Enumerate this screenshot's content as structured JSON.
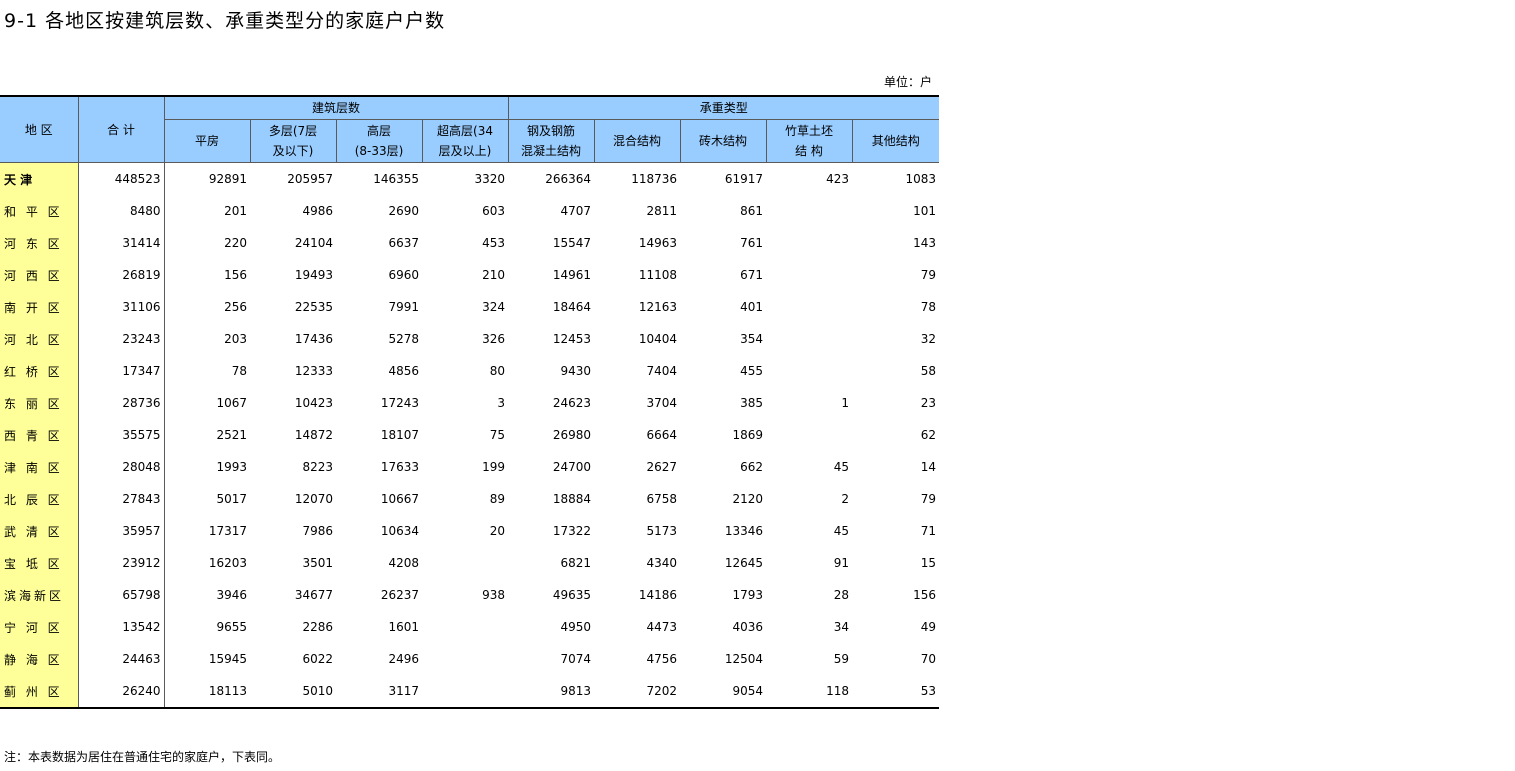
{
  "title": "9-1   各地区按建筑层数、承重类型分的家庭户户数",
  "unit": "单位：户",
  "note": "注：本表数据为居住在普通住宅的家庭户，下表同。",
  "header": {
    "region": "地      区",
    "total": "合  计",
    "group_floors": "建筑层数",
    "group_structure": "承重类型",
    "columns": [
      {
        "line1": "平房",
        "line2": ""
      },
      {
        "line1": "多层(7层",
        "line2": "及以下)"
      },
      {
        "line1": "高层",
        "line2": "(8-33层)"
      },
      {
        "line1": "超高层(34",
        "line2": "层及以上)"
      },
      {
        "line1": "钢及钢筋",
        "line2": "混凝土结构"
      },
      {
        "line1": "混合结构",
        "line2": ""
      },
      {
        "line1": "砖木结构",
        "line2": ""
      },
      {
        "line1": "竹草土坯",
        "line2": "结      构"
      },
      {
        "line1": "其他结构",
        "line2": ""
      }
    ]
  },
  "rows": [
    {
      "region": "天      津",
      "total": "448523",
      "c1": "92891",
      "c2": "205957",
      "c3": "146355",
      "c4": "3320",
      "c5": "266364",
      "c6": "118736",
      "c7": "61917",
      "c8": "423",
      "c9": "1083"
    },
    {
      "region": "和 平 区",
      "total": "8480",
      "c1": "201",
      "c2": "4986",
      "c3": "2690",
      "c4": "603",
      "c5": "4707",
      "c6": "2811",
      "c7": "861",
      "c8": "",
      "c9": "101"
    },
    {
      "region": "河 东 区",
      "total": "31414",
      "c1": "220",
      "c2": "24104",
      "c3": "6637",
      "c4": "453",
      "c5": "15547",
      "c6": "14963",
      "c7": "761",
      "c8": "",
      "c9": "143"
    },
    {
      "region": "河 西 区",
      "total": "26819",
      "c1": "156",
      "c2": "19493",
      "c3": "6960",
      "c4": "210",
      "c5": "14961",
      "c6": "11108",
      "c7": "671",
      "c8": "",
      "c9": "79"
    },
    {
      "region": "南 开 区",
      "total": "31106",
      "c1": "256",
      "c2": "22535",
      "c3": "7991",
      "c4": "324",
      "c5": "18464",
      "c6": "12163",
      "c7": "401",
      "c8": "",
      "c9": "78"
    },
    {
      "region": "河 北 区",
      "total": "23243",
      "c1": "203",
      "c2": "17436",
      "c3": "5278",
      "c4": "326",
      "c5": "12453",
      "c6": "10404",
      "c7": "354",
      "c8": "",
      "c9": "32"
    },
    {
      "region": "红 桥 区",
      "total": "17347",
      "c1": "78",
      "c2": "12333",
      "c3": "4856",
      "c4": "80",
      "c5": "9430",
      "c6": "7404",
      "c7": "455",
      "c8": "",
      "c9": "58"
    },
    {
      "region": "东 丽 区",
      "total": "28736",
      "c1": "1067",
      "c2": "10423",
      "c3": "17243",
      "c4": "3",
      "c5": "24623",
      "c6": "3704",
      "c7": "385",
      "c8": "1",
      "c9": "23"
    },
    {
      "region": "西 青 区",
      "total": "35575",
      "c1": "2521",
      "c2": "14872",
      "c3": "18107",
      "c4": "75",
      "c5": "26980",
      "c6": "6664",
      "c7": "1869",
      "c8": "",
      "c9": "62"
    },
    {
      "region": "津 南 区",
      "total": "28048",
      "c1": "1993",
      "c2": "8223",
      "c3": "17633",
      "c4": "199",
      "c5": "24700",
      "c6": "2627",
      "c7": "662",
      "c8": "45",
      "c9": "14"
    },
    {
      "region": "北 辰 区",
      "total": "27843",
      "c1": "5017",
      "c2": "12070",
      "c3": "10667",
      "c4": "89",
      "c5": "18884",
      "c6": "6758",
      "c7": "2120",
      "c8": "2",
      "c9": "79"
    },
    {
      "region": "武 清 区",
      "total": "35957",
      "c1": "17317",
      "c2": "7986",
      "c3": "10634",
      "c4": "20",
      "c5": "17322",
      "c6": "5173",
      "c7": "13346",
      "c8": "45",
      "c9": "71"
    },
    {
      "region": "宝 坻 区",
      "total": "23912",
      "c1": "16203",
      "c2": "3501",
      "c3": "4208",
      "c4": "",
      "c5": "6821",
      "c6": "4340",
      "c7": "12645",
      "c8": "91",
      "c9": "15"
    },
    {
      "region": "滨海新区",
      "total": "65798",
      "c1": "3946",
      "c2": "34677",
      "c3": "26237",
      "c4": "938",
      "c5": "49635",
      "c6": "14186",
      "c7": "1793",
      "c8": "28",
      "c9": "156"
    },
    {
      "region": "宁 河 区",
      "total": "13542",
      "c1": "9655",
      "c2": "2286",
      "c3": "1601",
      "c4": "",
      "c5": "4950",
      "c6": "4473",
      "c7": "4036",
      "c8": "34",
      "c9": "49"
    },
    {
      "region": "静 海 区",
      "total": "24463",
      "c1": "15945",
      "c2": "6022",
      "c3": "2496",
      "c4": "",
      "c5": "7074",
      "c6": "4756",
      "c7": "12504",
      "c8": "59",
      "c9": "70"
    },
    {
      "region": "蓟 州 区",
      "total": "26240",
      "c1": "18113",
      "c2": "5010",
      "c3": "3117",
      "c4": "",
      "c5": "9813",
      "c6": "7202",
      "c7": "9054",
      "c8": "118",
      "c9": "53"
    }
  ]
}
